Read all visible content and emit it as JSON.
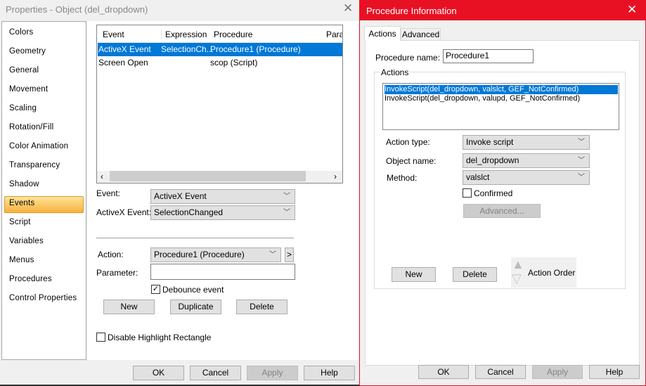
{
  "left_dialog": {
    "title": "Properties - Object (del_dropdown)",
    "sidebar": [
      "Colors",
      "Geometry",
      "General",
      "Movement",
      "Scaling",
      "Rotation/Fill",
      "Color Animation",
      "Transparency",
      "Shadow",
      "Events",
      "Script",
      "Variables",
      "Menus",
      "Procedures",
      "Control Properties"
    ],
    "selected_sidebar": "Events",
    "table": {
      "columns": [
        "Event",
        "Expression",
        "Procedure",
        "Paran"
      ],
      "rows": [
        {
          "event": "ActiveX Event",
          "expression": "SelectionCh...",
          "procedure": "Procedure1 (Procedure)",
          "selected": true
        },
        {
          "event": "Screen Open",
          "expression": "",
          "procedure": "scop (Script)",
          "selected": false
        }
      ]
    },
    "event_label": "Event:",
    "event_value": "ActiveX Event",
    "activex_label": "ActiveX Event:",
    "activex_value": "SelectionChanged",
    "action_label": "Action:",
    "action_value": "Procedure1 (Procedure)",
    "action_arrow": ">",
    "parameter_label": "Parameter:",
    "parameter_value": "",
    "debounce_label": "Debounce event",
    "debounce_checked": true,
    "new": "New",
    "duplicate": "Duplicate",
    "delete": "Delete",
    "disable_highlight_label": "Disable Highlight Rectangle",
    "disable_highlight_checked": false,
    "ok": "OK",
    "cancel": "Cancel",
    "apply": "Apply",
    "help": "Help"
  },
  "right_dialog": {
    "title": "Procedure Information",
    "title_color": "#e81123",
    "tabs": [
      "Actions",
      "Advanced"
    ],
    "procedure_name_label": "Procedure name:",
    "procedure_name_value": "Procedure1",
    "actions_group": "Actions",
    "actions": [
      "InvokeScript(del_dropdown, valslct, GEF_NotConfirmed)",
      "InvokeScript(del_dropdown, valupd, GEF_NotConfirmed)"
    ],
    "action_type_label": "Action type:",
    "action_type_value": "Invoke script",
    "object_name_label": "Object name:",
    "object_name_value": "del_dropdown",
    "method_label": "Method:",
    "method_value": "valslct",
    "confirmed_label": "Confirmed",
    "confirmed_checked": false,
    "advanced_btn": "Advanced...",
    "new": "New",
    "delete": "Delete",
    "action_order": "Action Order",
    "ok": "OK",
    "cancel": "Cancel",
    "apply": "Apply",
    "help": "Help"
  }
}
